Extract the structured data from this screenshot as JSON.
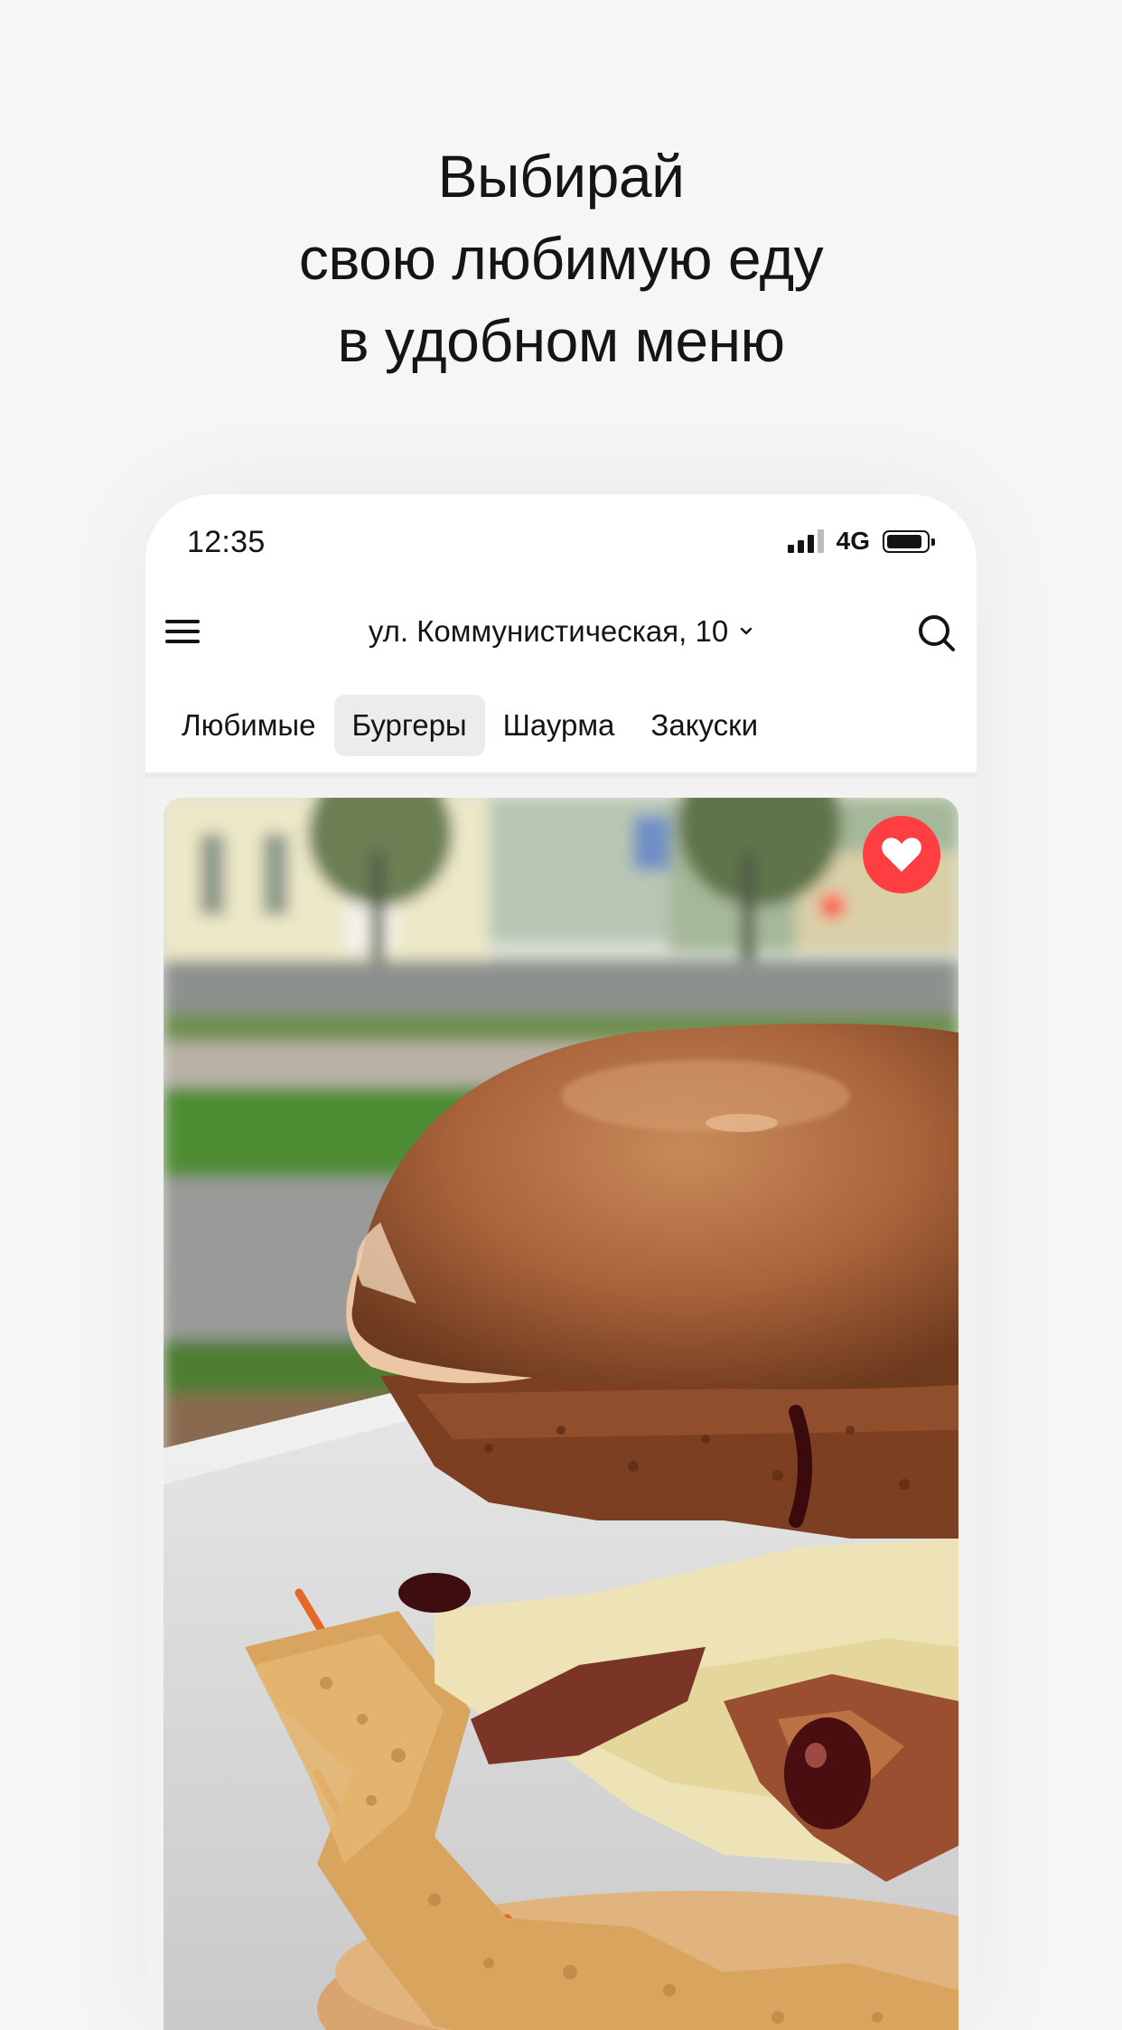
{
  "headline": {
    "line1": "Выбирай",
    "line2": "свою любимую еду",
    "line3": "в удобном меню"
  },
  "status_bar": {
    "time": "12:35",
    "network": "4G",
    "signal_icon": "signal-bars-icon",
    "battery_icon": "battery-icon"
  },
  "nav": {
    "menu_icon": "hamburger-menu-icon",
    "address": "ул. Коммунистическая, 10",
    "address_icon": "chevron-down-icon",
    "search_icon": "search-icon"
  },
  "tabs": [
    {
      "label": "Любимые",
      "active": false
    },
    {
      "label": "Бургеры",
      "active": true
    },
    {
      "label": "Шаурма",
      "active": false
    },
    {
      "label": "Закуски",
      "active": false
    }
  ],
  "card": {
    "image": "burger-photo",
    "favorite_icon": "heart-icon",
    "favorite": true
  },
  "colors": {
    "background": "#f6f6f6",
    "accent_red": "#ff3e42",
    "active_tab": "#ececec",
    "text": "#141414"
  }
}
